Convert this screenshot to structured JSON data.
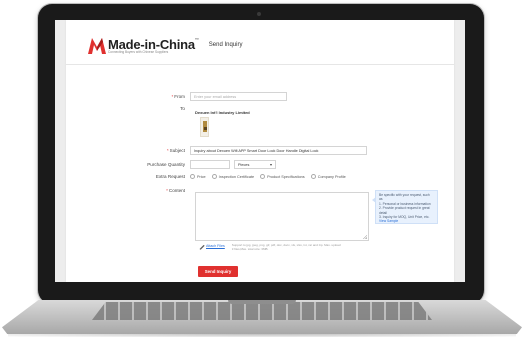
{
  "header": {
    "logo_text": "Made-in-China",
    "logo_tm": "™",
    "logo_tagline": "Connecting Buyers with Chinese Suppliers",
    "title": "Send Inquiry"
  },
  "form": {
    "from": {
      "label": "From",
      "placeholder": "Enter your email address"
    },
    "to": {
      "label": "To",
      "company": "Dexuen Int'l Industry Limited"
    },
    "subject": {
      "label": "Subject",
      "value": "Inquiry about Dexuen Wifi APP Smart Door Lock Door Handle Digital Lock"
    },
    "quantity": {
      "label": "Purchase Quantity",
      "unit": "Pieces"
    },
    "extra": {
      "label": "Extra Request",
      "options": [
        "Price",
        "Inspection Certificate",
        "Product Specifications",
        "Company Profile"
      ]
    },
    "content": {
      "label": "Content"
    },
    "tip": {
      "lines": [
        "Be specific with your request, such as",
        "1. Personal or business information",
        "2. Provide product request in great detail",
        "3. Inquiry for MOQ, Unit Price, etc."
      ],
      "link": "View Sample"
    },
    "attach": {
      "label": "Attach Files",
      "note": "Support to jpg, jpeg, png, gif, pdf, doc, docx, xls, xlsx, txt, rar and zip. Max. upload 3 files,Max. total size: 3MB."
    },
    "send_label": "Send Inquiry"
  },
  "colors": {
    "brand_red": "#e0312f",
    "link_blue": "#2a6fd6",
    "tip_bg": "#e8f1fd"
  }
}
